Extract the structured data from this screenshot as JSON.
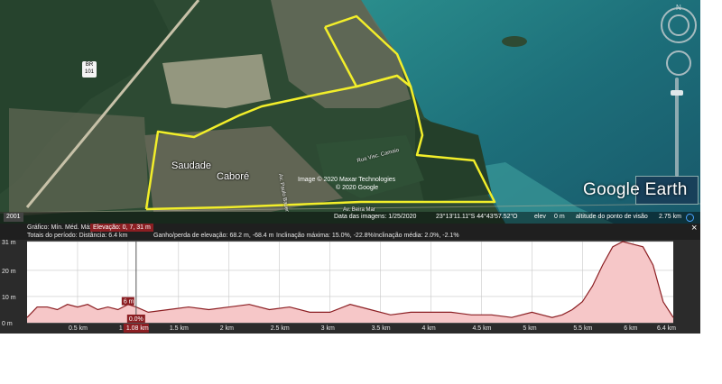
{
  "map": {
    "places": [
      "Saudade",
      "Caboré"
    ],
    "roads": [
      "Av. Beira Mar",
      "Av. Paulo Bauer",
      "Rua Visc. Camaio"
    ],
    "highway_shield": "BR\n101",
    "attribution": [
      "Image © 2020 Maxar Technologies",
      "© 2020 Google"
    ],
    "logo": "Google Earth",
    "year_badge": "2001",
    "status": {
      "image_date": "Data das imagens: 1/25/2020",
      "coords": "23°13'11.11\"S   44°43'57.52\"O",
      "elev_label": "elev",
      "elev_value": "0 m",
      "eye_alt": "altitude do ponto de visão",
      "eye_value": "2.75 km"
    },
    "route_color": "#f2ee2a",
    "nav_icons": [
      "compass-icon",
      "look-joystick-icon",
      "move-joystick-icon",
      "zoom-slider-icon"
    ]
  },
  "profile": {
    "close": "×",
    "row1": {
      "graph_label": "Gráfico: Mín. Méd. Máx.",
      "elevation": "Elevação: 0, 7, 31 m"
    },
    "row2": {
      "totals": "Totais do período:  Distância: 6.4 km",
      "gain": "Ganho/perda de elevação: 68.2 m, -68.4 m",
      "max_slope": "Inclinação máxima: 15.0%, -22.8%",
      "avg_slope": "Inclinação média: 2.0%, -2.1%"
    },
    "y_ticks": [
      "31 m",
      "20 m",
      "10 m",
      "0 m"
    ],
    "x_ticks": [
      "0.5 km",
      "1 km",
      "1.5 km",
      "2 km",
      "2.5 km",
      "3 km",
      "3.5 km",
      "4 km",
      "4.5 km",
      "5 km",
      "5.5 km",
      "6 km",
      "6.4 km"
    ],
    "cursor": {
      "elev": "6 m",
      "slope": "0.0%",
      "dist": "1.08 km"
    },
    "fill_color": "#f6c7c8",
    "line_color": "#8b1e22"
  },
  "chart_data": {
    "type": "area",
    "xlabel": "",
    "ylabel": "",
    "xlim": [
      0,
      6.4
    ],
    "ylim": [
      0,
      31
    ],
    "grid": true,
    "x": [
      0,
      0.1,
      0.2,
      0.3,
      0.4,
      0.5,
      0.6,
      0.7,
      0.8,
      0.9,
      1.0,
      1.08,
      1.2,
      1.4,
      1.6,
      1.8,
      2.0,
      2.2,
      2.4,
      2.6,
      2.8,
      3.0,
      3.2,
      3.4,
      3.6,
      3.8,
      4.0,
      4.2,
      4.4,
      4.6,
      4.8,
      5.0,
      5.1,
      5.2,
      5.3,
      5.4,
      5.5,
      5.6,
      5.7,
      5.8,
      5.9,
      6.0,
      6.1,
      6.2,
      6.3,
      6.4
    ],
    "y": [
      2,
      6,
      6,
      5,
      7,
      6,
      7,
      5,
      6,
      5,
      7,
      6,
      4,
      5,
      6,
      5,
      6,
      7,
      5,
      6,
      4,
      4,
      7,
      5,
      3,
      4,
      4,
      4,
      3,
      3,
      2,
      4,
      3,
      2,
      3,
      5,
      8,
      14,
      22,
      29,
      31,
      30,
      29,
      22,
      8,
      2
    ]
  }
}
